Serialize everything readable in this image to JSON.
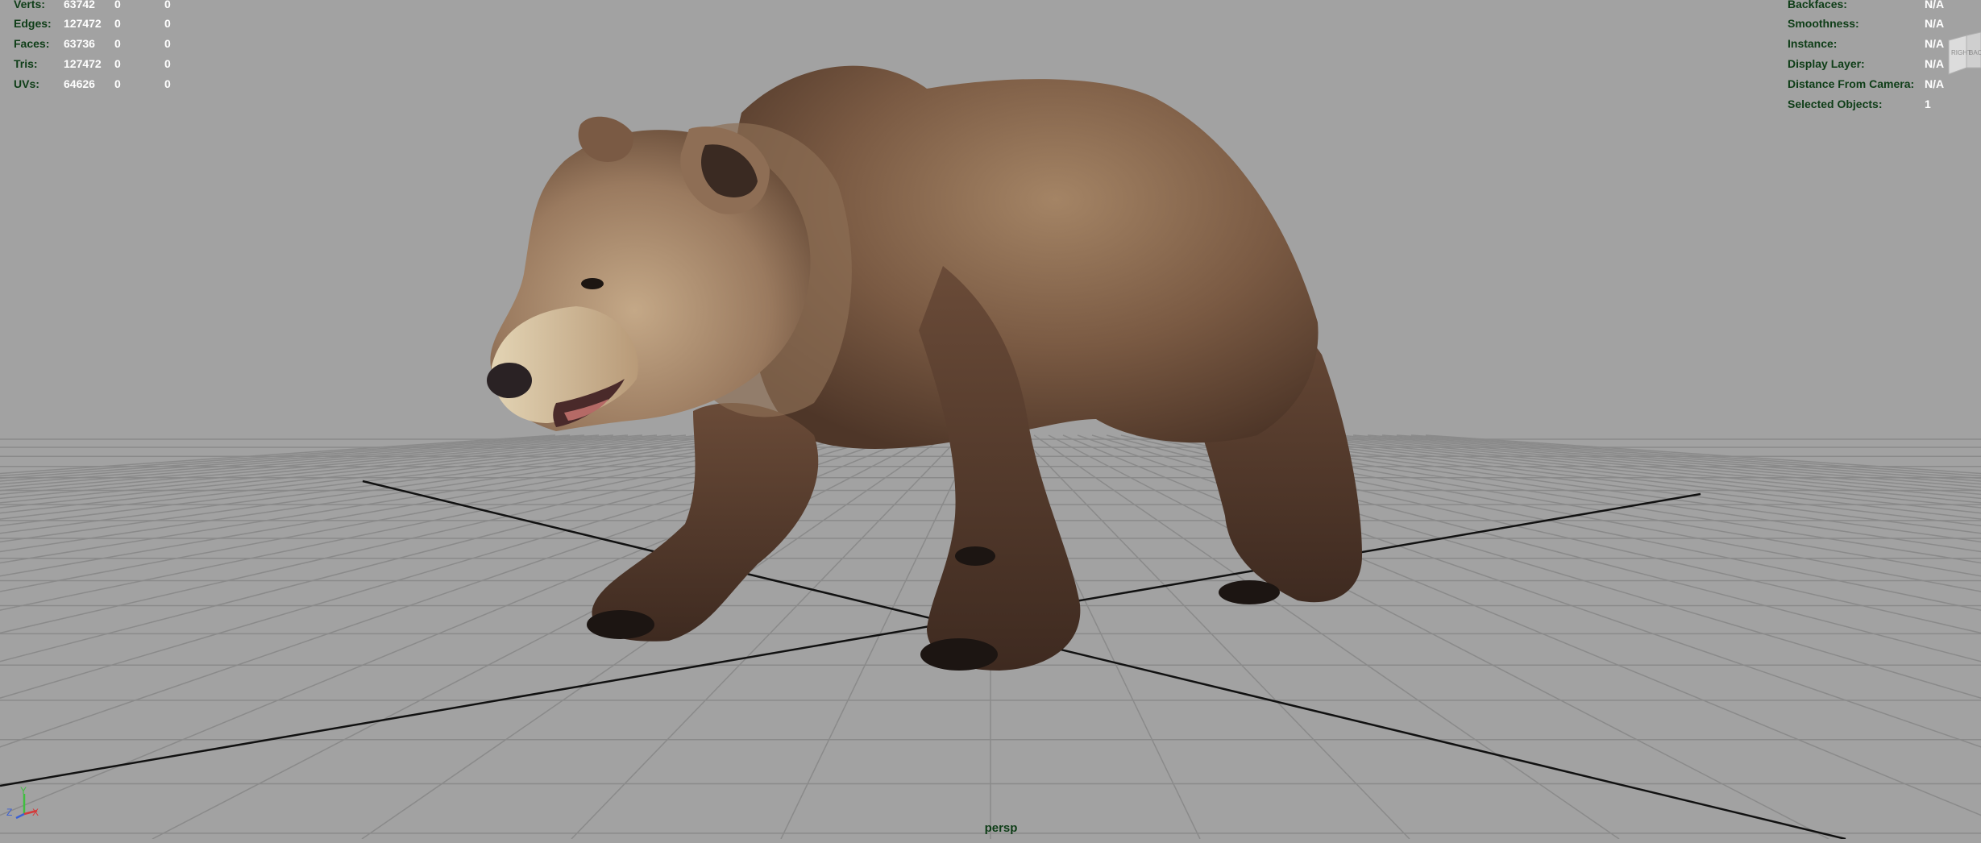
{
  "viewport": {
    "camera_name": "persp",
    "background_color": "#a2a2a2",
    "grid_color": "#8a8a8a",
    "axis_line_color": "#111111",
    "hud_label_color": "#0e3d17",
    "hud_value_color": "#ffffff",
    "model": "brown-bear",
    "heads_up_display": {
      "poly_count": [
        {
          "label": "Verts:",
          "values": [
            "63742",
            "0",
            "0"
          ]
        },
        {
          "label": "Edges:",
          "values": [
            "127472",
            "0",
            "0"
          ]
        },
        {
          "label": "Faces:",
          "values": [
            "63736",
            "0",
            "0"
          ]
        },
        {
          "label": "Tris:",
          "values": [
            "127472",
            "0",
            "0"
          ]
        },
        {
          "label": "UVs:",
          "values": [
            "64626",
            "0",
            "0"
          ]
        }
      ],
      "object_details": [
        {
          "label": "Backfaces:",
          "value": "N/A"
        },
        {
          "label": "Smoothness:",
          "value": "N/A"
        },
        {
          "label": "Instance:",
          "value": "N/A"
        },
        {
          "label": "Display Layer:",
          "value": "N/A"
        },
        {
          "label": "Distance From Camera:",
          "value": "N/A"
        },
        {
          "label": "Selected Objects:",
          "value": "1"
        }
      ]
    },
    "view_cube": {
      "faces": [
        "RIGHT",
        "BACK"
      ]
    },
    "axis_gizmo": {
      "labels": [
        "Y",
        "Z",
        "X"
      ]
    }
  }
}
